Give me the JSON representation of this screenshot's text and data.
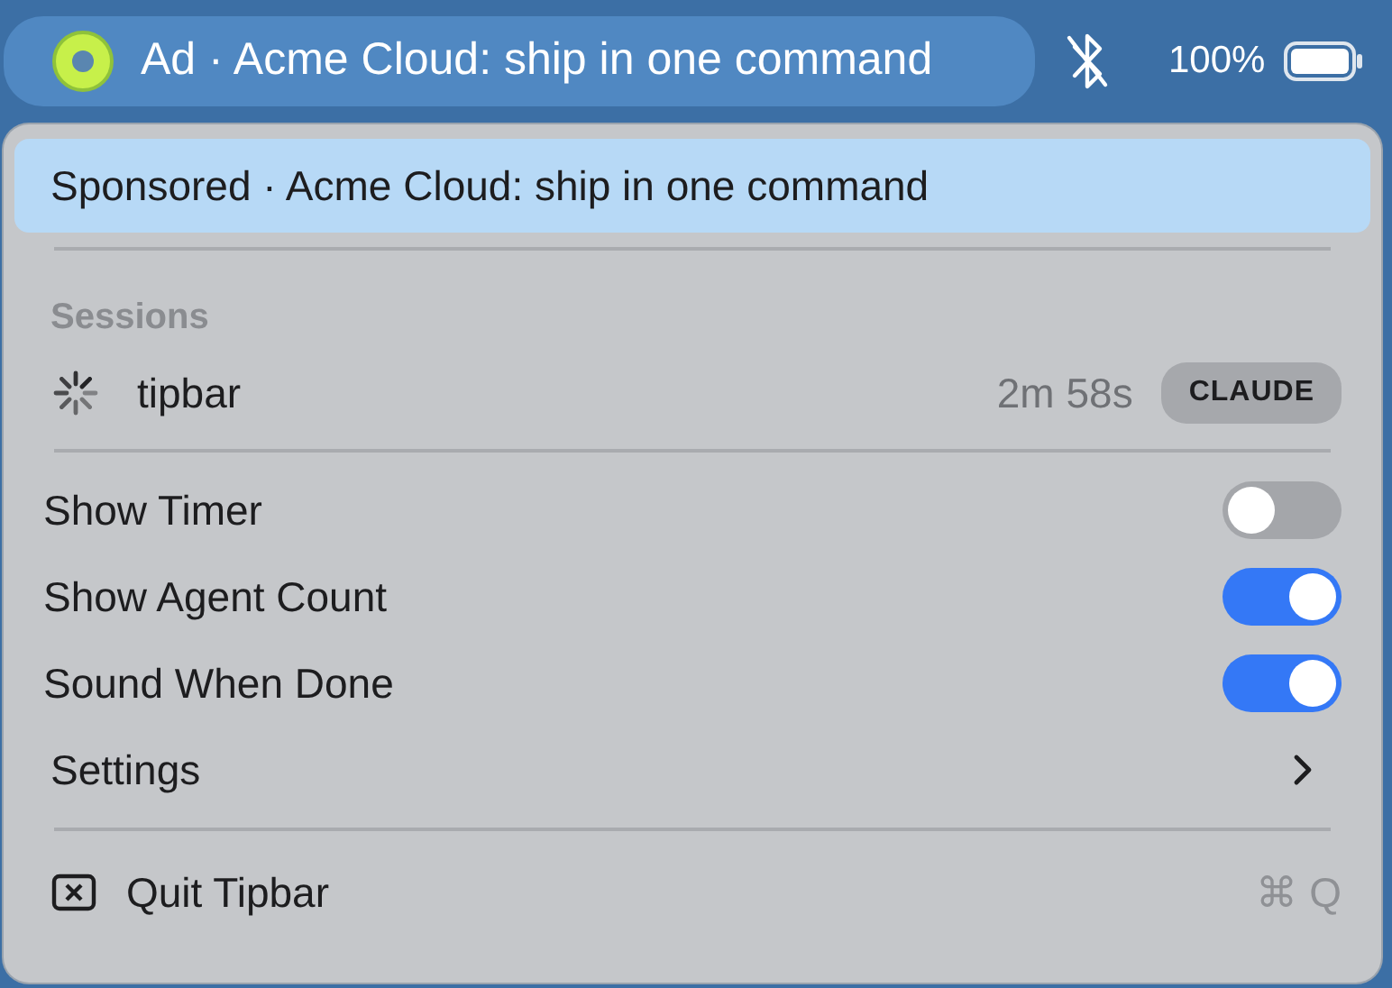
{
  "menu_bar": {
    "status_text": "Ad · Acme Cloud: ship in one command",
    "battery": "100%"
  },
  "menu": {
    "sponsored": {
      "text": "Sponsored · Acme Cloud: ship in one command",
      "selected": true
    },
    "sessions_header": "Sessions",
    "sessions": [
      {
        "name": "tipbar",
        "elapsed": "2m 58s",
        "agent": "CLAUDE"
      }
    ],
    "options": [
      {
        "kind": "toggle",
        "label": "Show Timer",
        "on": false
      },
      {
        "kind": "toggle",
        "label": "Show Agent Count",
        "on": true
      },
      {
        "kind": "toggle",
        "label": "Sound When Done",
        "on": true
      },
      {
        "kind": "submenu",
        "label": "Settings"
      }
    ],
    "quit": {
      "label": "Quit Tipbar",
      "shortcut": "⌘ Q"
    }
  }
}
